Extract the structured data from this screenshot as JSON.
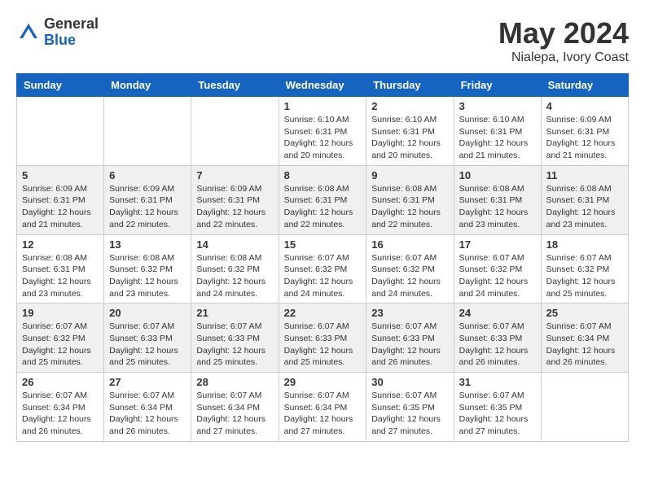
{
  "header": {
    "logo_general": "General",
    "logo_blue": "Blue",
    "title": "May 2024",
    "location": "Nialepa, Ivory Coast"
  },
  "days_of_week": [
    "Sunday",
    "Monday",
    "Tuesday",
    "Wednesday",
    "Thursday",
    "Friday",
    "Saturday"
  ],
  "weeks": [
    [
      {
        "day": "",
        "info": ""
      },
      {
        "day": "",
        "info": ""
      },
      {
        "day": "",
        "info": ""
      },
      {
        "day": "1",
        "info": "Sunrise: 6:10 AM\nSunset: 6:31 PM\nDaylight: 12 hours and 20 minutes."
      },
      {
        "day": "2",
        "info": "Sunrise: 6:10 AM\nSunset: 6:31 PM\nDaylight: 12 hours and 20 minutes."
      },
      {
        "day": "3",
        "info": "Sunrise: 6:10 AM\nSunset: 6:31 PM\nDaylight: 12 hours and 21 minutes."
      },
      {
        "day": "4",
        "info": "Sunrise: 6:09 AM\nSunset: 6:31 PM\nDaylight: 12 hours and 21 minutes."
      }
    ],
    [
      {
        "day": "5",
        "info": "Sunrise: 6:09 AM\nSunset: 6:31 PM\nDaylight: 12 hours and 21 minutes."
      },
      {
        "day": "6",
        "info": "Sunrise: 6:09 AM\nSunset: 6:31 PM\nDaylight: 12 hours and 22 minutes."
      },
      {
        "day": "7",
        "info": "Sunrise: 6:09 AM\nSunset: 6:31 PM\nDaylight: 12 hours and 22 minutes."
      },
      {
        "day": "8",
        "info": "Sunrise: 6:08 AM\nSunset: 6:31 PM\nDaylight: 12 hours and 22 minutes."
      },
      {
        "day": "9",
        "info": "Sunrise: 6:08 AM\nSunset: 6:31 PM\nDaylight: 12 hours and 22 minutes."
      },
      {
        "day": "10",
        "info": "Sunrise: 6:08 AM\nSunset: 6:31 PM\nDaylight: 12 hours and 23 minutes."
      },
      {
        "day": "11",
        "info": "Sunrise: 6:08 AM\nSunset: 6:31 PM\nDaylight: 12 hours and 23 minutes."
      }
    ],
    [
      {
        "day": "12",
        "info": "Sunrise: 6:08 AM\nSunset: 6:31 PM\nDaylight: 12 hours and 23 minutes."
      },
      {
        "day": "13",
        "info": "Sunrise: 6:08 AM\nSunset: 6:32 PM\nDaylight: 12 hours and 23 minutes."
      },
      {
        "day": "14",
        "info": "Sunrise: 6:08 AM\nSunset: 6:32 PM\nDaylight: 12 hours and 24 minutes."
      },
      {
        "day": "15",
        "info": "Sunrise: 6:07 AM\nSunset: 6:32 PM\nDaylight: 12 hours and 24 minutes."
      },
      {
        "day": "16",
        "info": "Sunrise: 6:07 AM\nSunset: 6:32 PM\nDaylight: 12 hours and 24 minutes."
      },
      {
        "day": "17",
        "info": "Sunrise: 6:07 AM\nSunset: 6:32 PM\nDaylight: 12 hours and 24 minutes."
      },
      {
        "day": "18",
        "info": "Sunrise: 6:07 AM\nSunset: 6:32 PM\nDaylight: 12 hours and 25 minutes."
      }
    ],
    [
      {
        "day": "19",
        "info": "Sunrise: 6:07 AM\nSunset: 6:32 PM\nDaylight: 12 hours and 25 minutes."
      },
      {
        "day": "20",
        "info": "Sunrise: 6:07 AM\nSunset: 6:33 PM\nDaylight: 12 hours and 25 minutes."
      },
      {
        "day": "21",
        "info": "Sunrise: 6:07 AM\nSunset: 6:33 PM\nDaylight: 12 hours and 25 minutes."
      },
      {
        "day": "22",
        "info": "Sunrise: 6:07 AM\nSunset: 6:33 PM\nDaylight: 12 hours and 25 minutes."
      },
      {
        "day": "23",
        "info": "Sunrise: 6:07 AM\nSunset: 6:33 PM\nDaylight: 12 hours and 26 minutes."
      },
      {
        "day": "24",
        "info": "Sunrise: 6:07 AM\nSunset: 6:33 PM\nDaylight: 12 hours and 26 minutes."
      },
      {
        "day": "25",
        "info": "Sunrise: 6:07 AM\nSunset: 6:34 PM\nDaylight: 12 hours and 26 minutes."
      }
    ],
    [
      {
        "day": "26",
        "info": "Sunrise: 6:07 AM\nSunset: 6:34 PM\nDaylight: 12 hours and 26 minutes."
      },
      {
        "day": "27",
        "info": "Sunrise: 6:07 AM\nSunset: 6:34 PM\nDaylight: 12 hours and 26 minutes."
      },
      {
        "day": "28",
        "info": "Sunrise: 6:07 AM\nSunset: 6:34 PM\nDaylight: 12 hours and 27 minutes."
      },
      {
        "day": "29",
        "info": "Sunrise: 6:07 AM\nSunset: 6:34 PM\nDaylight: 12 hours and 27 minutes."
      },
      {
        "day": "30",
        "info": "Sunrise: 6:07 AM\nSunset: 6:35 PM\nDaylight: 12 hours and 27 minutes."
      },
      {
        "day": "31",
        "info": "Sunrise: 6:07 AM\nSunset: 6:35 PM\nDaylight: 12 hours and 27 minutes."
      },
      {
        "day": "",
        "info": ""
      }
    ]
  ]
}
